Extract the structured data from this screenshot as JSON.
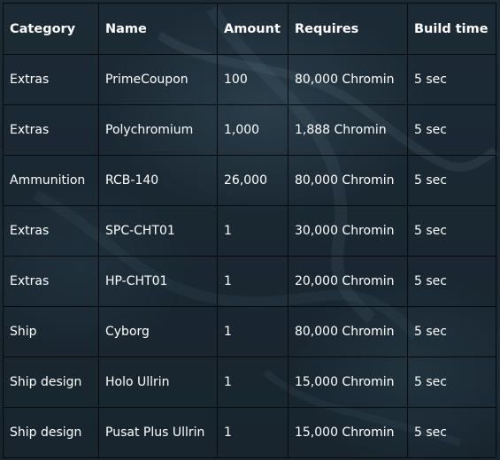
{
  "table": {
    "headers": [
      "Category",
      "Name",
      "Amount",
      "Requires",
      "Build time"
    ],
    "rows": [
      [
        "Extras",
        "PrimeCoupon",
        "100",
        "80,000 Chromin",
        "5 sec"
      ],
      [
        "Extras",
        "Polychromium",
        "1,000",
        "1,888 Chromin",
        "5 sec"
      ],
      [
        "Ammunition",
        "RCB-140",
        "26,000",
        "80,000 Chromin",
        "5 sec"
      ],
      [
        "Extras",
        "SPC-CHT01",
        "1",
        "30,000 Chromin",
        "5 sec"
      ],
      [
        "Extras",
        "HP-CHT01",
        "1",
        "20,000 Chromin",
        "5 sec"
      ],
      [
        "Ship",
        "Cyborg",
        "1",
        "80,000 Chromin",
        "5 sec"
      ],
      [
        "Ship design",
        "Holo Ullrin",
        "1",
        "15,000 Chromin",
        "5 sec"
      ],
      [
        "Ship design",
        "Pusat Plus Ullrin",
        "1",
        "15,000 Chromin",
        "5 sec"
      ]
    ]
  }
}
